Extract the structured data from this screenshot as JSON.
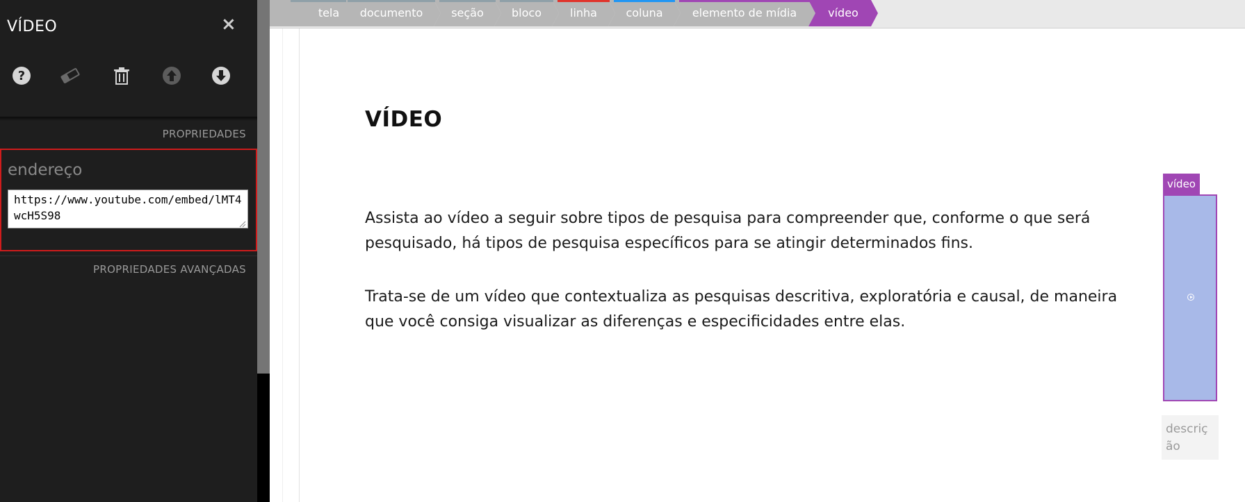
{
  "panel": {
    "title": "VÍDEO",
    "close_label": "×",
    "toolbar": {
      "help_icon": "help-circle-icon",
      "eraser_icon": "eraser-icon",
      "delete_icon": "trash-icon",
      "move_up_icon": "arrow-up-circle-icon",
      "move_down_icon": "arrow-down-circle-icon"
    },
    "properties_title": "PROPRIEDADES",
    "field_label": "endereço",
    "field_value": "https://www.youtube.com/embed/lMT4wcH5S98",
    "advanced_title": "PROPRIEDADES AVANÇADAS"
  },
  "breadcrumb": [
    {
      "label": "tela",
      "accent": "#b6b6b6"
    },
    {
      "label": "documento",
      "accent": "#8fa0a8"
    },
    {
      "label": "seção",
      "accent": "#8fa0a8"
    },
    {
      "label": "bloco",
      "accent": "#8fa0a8"
    },
    {
      "label": "linha",
      "accent": "#e0342c"
    },
    {
      "label": "coluna",
      "accent": "#2196f3"
    },
    {
      "label": "elemento de mídia",
      "accent": "#a046b4"
    },
    {
      "label": "vídeo",
      "accent": "#a046b4"
    }
  ],
  "document": {
    "title": "VÍDEO",
    "paragraphs": [
      "Assista ao vídeo a seguir sobre tipos de pesquisa para compreender que, conforme o que será pesquisado, há tipos de pesquisa específicos para se atingir determinados fins.",
      "Trata-se de um vídeo que contextualiza as pesquisas descritiva, exploratória e causal, de maneira que você consiga visualizar as diferenças e especificidades entre elas."
    ]
  },
  "video": {
    "tag_label": "vídeo",
    "caption_placeholder": "descrição"
  },
  "colors": {
    "accent": "#a046b4",
    "panel_bg": "#1e1e1e",
    "highlight_border": "#d01c1c"
  }
}
